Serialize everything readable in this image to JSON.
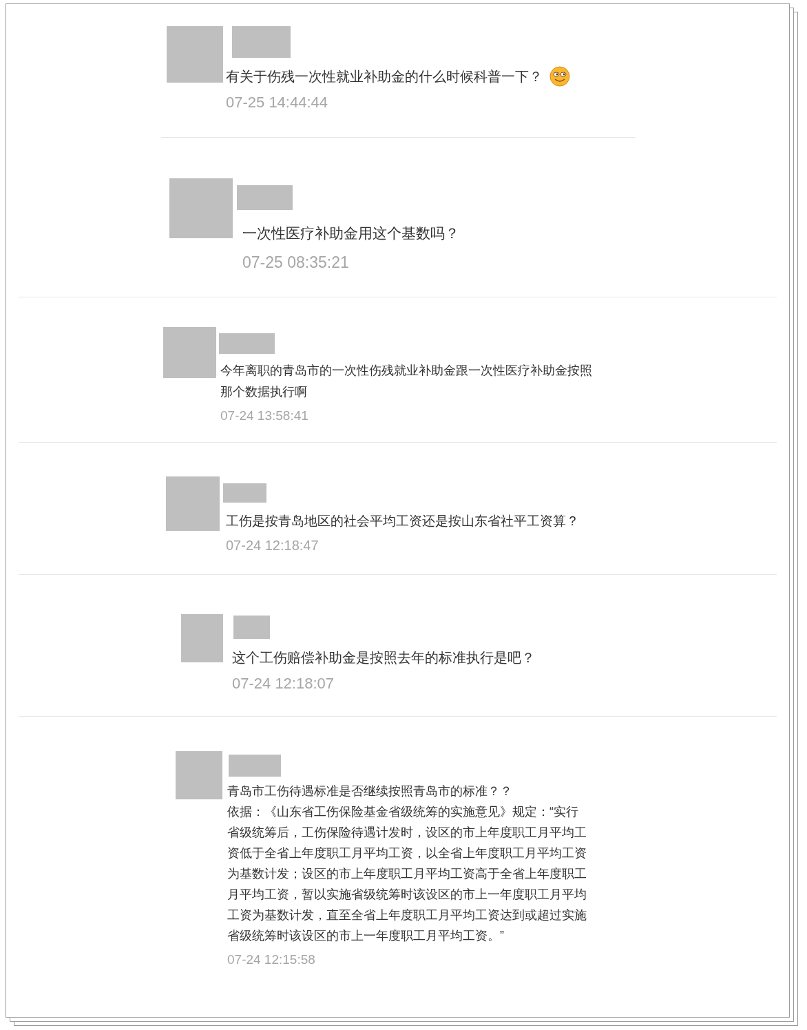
{
  "comments": [
    {
      "paragraphs": [
        "有关于伤残一次性就业补助金的什么时候科普一下？"
      ],
      "has_emoji": true,
      "time": "07-25 14:44:44"
    },
    {
      "paragraphs": [
        "一次性医疗补助金用这个基数吗？"
      ],
      "has_emoji": false,
      "time": "07-25 08:35:21"
    },
    {
      "paragraphs": [
        "今年离职的青岛市的一次性伤残就业补助金跟一次性医疗补助金按照那个数据执行啊"
      ],
      "has_emoji": false,
      "time": "07-24 13:58:41"
    },
    {
      "paragraphs": [
        "工伤是按青岛地区的社会平均工资还是按山东省社平工资算？"
      ],
      "has_emoji": false,
      "time": "07-24 12:18:47"
    },
    {
      "paragraphs": [
        "这个工伤赔偿补助金是按照去年的标准执行是吧？"
      ],
      "has_emoji": false,
      "time": "07-24 12:18:07"
    },
    {
      "paragraphs": [
        "青岛市工伤待遇标准是否继续按照青岛市的标准？？",
        "依据：《山东省工伤保险基金省级统筹的实施意见》规定：“实行省级统筹后，工伤保险待遇计发时，设区的市上年度职工月平均工资低于全省上年度职工月平均工资，以全省上年度职工月平均工资为基数计发；设区的市上年度职工月平均工资高于全省上年度职工月平均工资，暂以实施省级统筹时该设区的市上一年度职工月平均工资为基数计发，直至全省上年度职工月平均工资达到或超过实施省级统筹时该设区的市上一年度职工月平均工资。”"
      ],
      "has_emoji": false,
      "time": "07-24 12:15:58"
    }
  ]
}
